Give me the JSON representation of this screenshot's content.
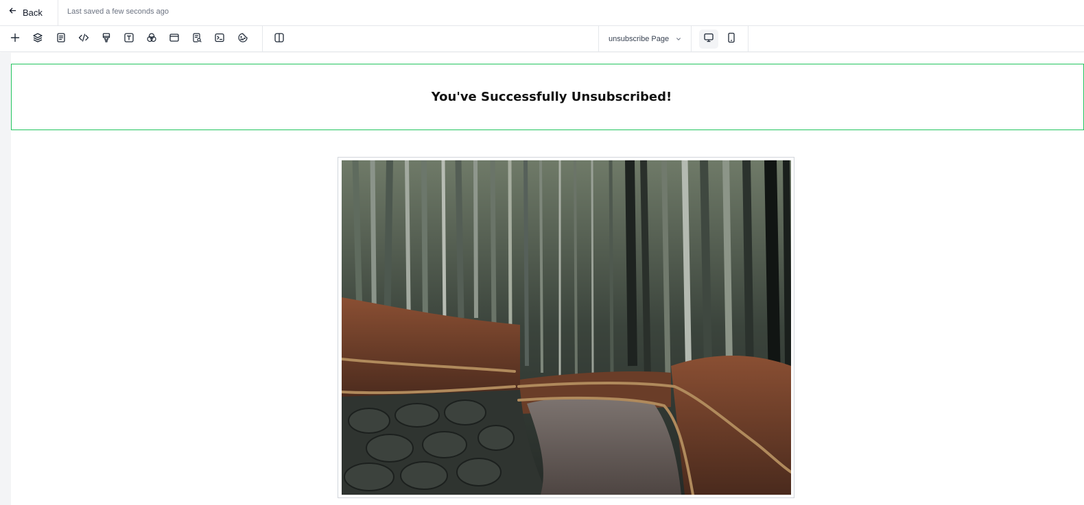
{
  "topbar": {
    "back_label": "Back",
    "saved_status": "Last saved a few seconds ago"
  },
  "toolbar": {
    "tools": [
      {
        "icon": "plus-icon"
      },
      {
        "icon": "layers-icon"
      },
      {
        "icon": "page-icon"
      },
      {
        "icon": "code-icon"
      },
      {
        "icon": "paint-brush-icon"
      },
      {
        "icon": "text-icon"
      },
      {
        "icon": "color-circles-icon"
      },
      {
        "icon": "browser-window-icon"
      },
      {
        "icon": "page-search-icon"
      },
      {
        "icon": "terminal-icon"
      },
      {
        "icon": "cookie-icon"
      },
      {
        "icon": "split-view-icon"
      }
    ],
    "page_select": {
      "selected": "unsubscribe Page"
    },
    "devices": [
      {
        "icon": "desktop-icon",
        "active": true
      },
      {
        "icon": "mobile-icon",
        "active": false
      }
    ]
  },
  "canvas": {
    "heading": "You've Successfully Unsubscribed!",
    "selection_color": "#22c55e",
    "image": {
      "subject": "bamboo-forest-path-photo"
    }
  }
}
